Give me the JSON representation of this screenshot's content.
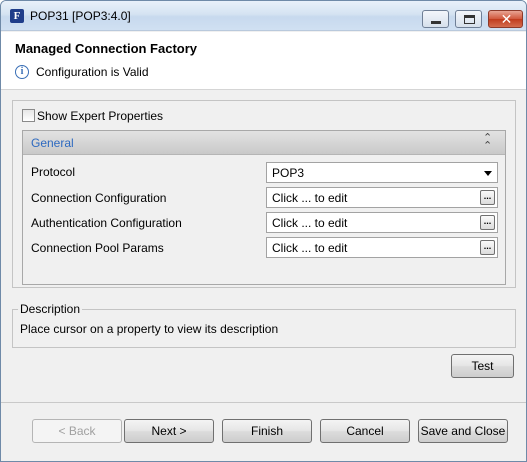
{
  "window": {
    "title": "POP31 [POP3:4.0]",
    "app_icon_letter": "F",
    "controls": [
      "minimize-icon",
      "maximize-icon",
      "close-icon"
    ],
    "close_glyph": "✕"
  },
  "header": {
    "title": "Managed Connection Factory",
    "status": "Configuration is Valid",
    "status_icon": "info-icon",
    "info_glyph": "i"
  },
  "options": {
    "show_expert_label": "Show Expert Properties",
    "show_expert_checked": false
  },
  "section": {
    "title": "General",
    "collapse_glyph": "⌃⌃",
    "properties": [
      {
        "label": "Protocol",
        "value": "POP3",
        "type": "dropdown"
      },
      {
        "label": "Connection Configuration",
        "value": "Click ... to edit",
        "button": "..."
      },
      {
        "label": "Authentication Configuration",
        "value": "Click ... to edit",
        "button": "..."
      },
      {
        "label": "Connection Pool Params",
        "value": "Click ... to edit",
        "button": "..."
      }
    ]
  },
  "description": {
    "title": "Description",
    "text": "Place cursor on a property to view its description"
  },
  "buttons": {
    "test": "Test",
    "back": "< Back",
    "next": "Next >",
    "finish": "Finish",
    "cancel": "Cancel",
    "save_close": "Save and Close"
  },
  "colors": {
    "section_title": "#2e6ac0",
    "info_icon": "#3a6fb6",
    "close_button": "#c03b1d"
  }
}
